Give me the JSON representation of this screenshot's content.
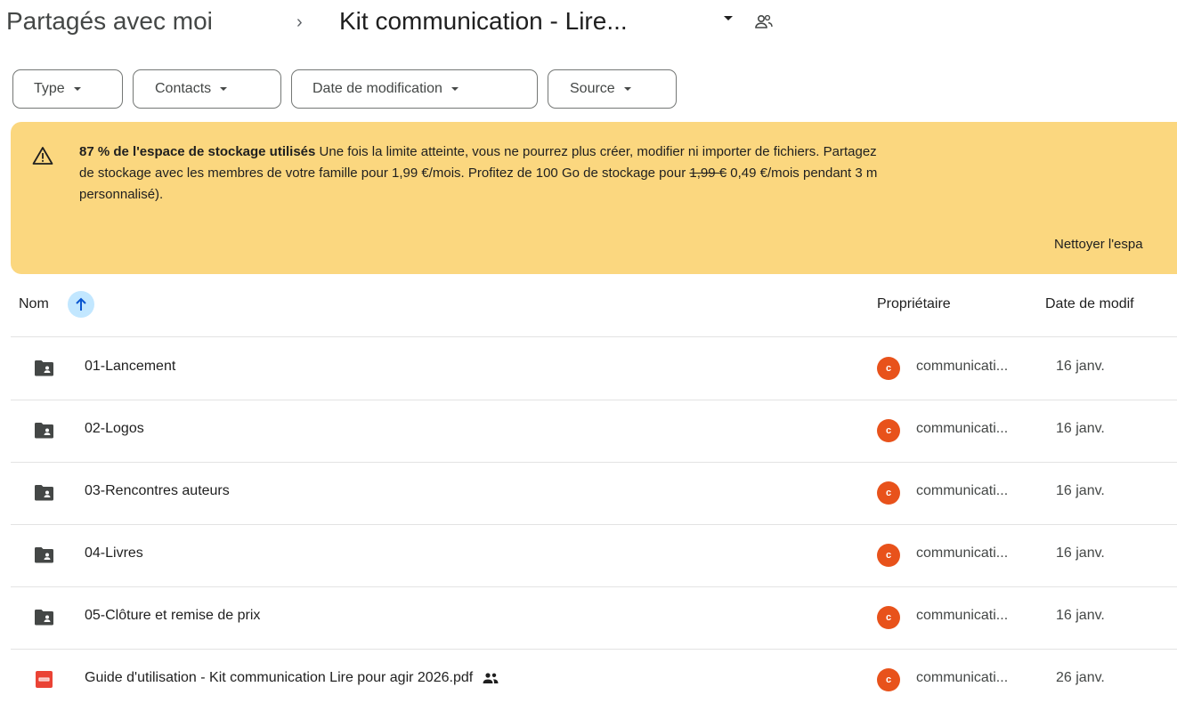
{
  "breadcrumb": {
    "root": "Partagés avec moi",
    "separator": "›",
    "current": "Kit communication - Lire..."
  },
  "filters": [
    {
      "label": "Type"
    },
    {
      "label": "Contacts"
    },
    {
      "label": "Date de modification"
    },
    {
      "label": "Source"
    }
  ],
  "banner": {
    "bold": "87 % de l'espace de stockage utilisés",
    "text1": " Une fois la limite atteinte, vous ne pourrez plus créer, modifier ni importer de fichiers. Partagez",
    "text2": "de stockage avec les membres de votre famille pour 1,99 €/mois. Profitez de 100 Go de stockage pour ",
    "old_price": "1,99 €",
    "text3": " 0,49 €/mois pendant 3 m",
    "text4": "personnalisé).",
    "action": "Nettoyer l'espa",
    "color": "#fbd77f"
  },
  "table": {
    "col_name": "Nom",
    "col_owner": "Propriétaire",
    "col_date": "Date de modif",
    "rows": [
      {
        "name": "01-Lancement",
        "type": "folder",
        "owner_initial": "c",
        "owner": "communicati...",
        "date": "16 janv."
      },
      {
        "name": "02-Logos",
        "type": "folder",
        "owner_initial": "c",
        "owner": "communicati...",
        "date": "16 janv."
      },
      {
        "name": "03-Rencontres auteurs",
        "type": "folder",
        "owner_initial": "c",
        "owner": "communicati...",
        "date": "16 janv."
      },
      {
        "name": "04-Livres",
        "type": "folder",
        "owner_initial": "c",
        "owner": "communicati...",
        "date": "16 janv."
      },
      {
        "name": "05-Clôture et remise de prix",
        "type": "folder",
        "owner_initial": "c",
        "owner": "communicati...",
        "date": "16 janv."
      },
      {
        "name": "Guide d'utilisation - Kit communication Lire pour agir 2026.pdf",
        "type": "pdf",
        "shared": true,
        "owner_initial": "c",
        "owner": "communicati...",
        "date": "26 janv."
      }
    ]
  },
  "colors": {
    "accent": "#c2e7ff",
    "avatar": "#e8521b",
    "pdf": "#ea4335"
  }
}
